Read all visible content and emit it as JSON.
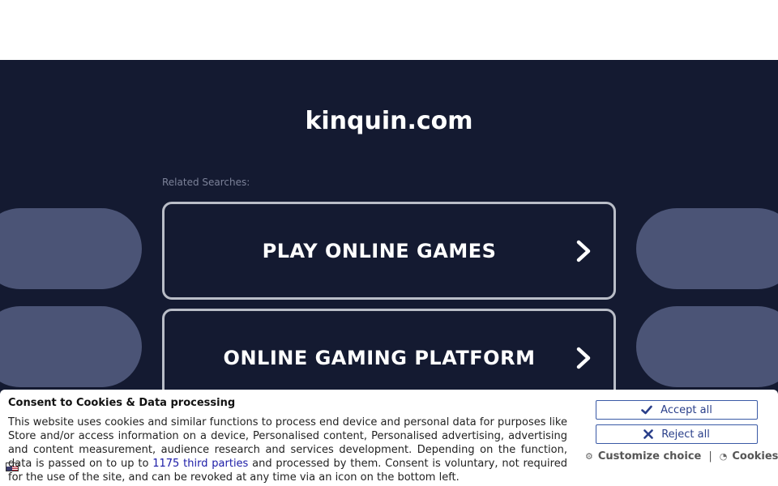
{
  "page": {
    "domain": "kinquin.com",
    "related_label": "Related Searches:"
  },
  "searches": [
    {
      "label": "PLAY ONLINE GAMES"
    },
    {
      "label": "ONLINE GAMING PLATFORM"
    }
  ],
  "consent": {
    "title": "Consent to Cookies & Data processing",
    "text_before_link": "This website uses cookies and similar functions to process end device and personal data for purposes like Store and/or access information on a device, Personalised content, Personalised advertising, advertising and content measurement, audience research and services development. Depending on the function, data is passed on to up to ",
    "link_text": "1175 third parties",
    "text_after_link": " and processed by them. Consent is voluntary, not required for the use of the site, and can be revoked at any time via an icon on the bottom left.",
    "accept_label": "Accept all",
    "reject_label": "Reject all",
    "customize_label": "Customize choice",
    "cookies_label": "Cookies",
    "separator": "|"
  },
  "colors": {
    "background": "#141a31",
    "pill": "#4b5476",
    "button_border": "#b9bdc7",
    "consent_button": "#2a3f8a"
  },
  "icons": [
    "chevron-right-icon",
    "check-icon",
    "x-icon",
    "gear-icon",
    "cookie-icon",
    "language-flag-icon"
  ]
}
